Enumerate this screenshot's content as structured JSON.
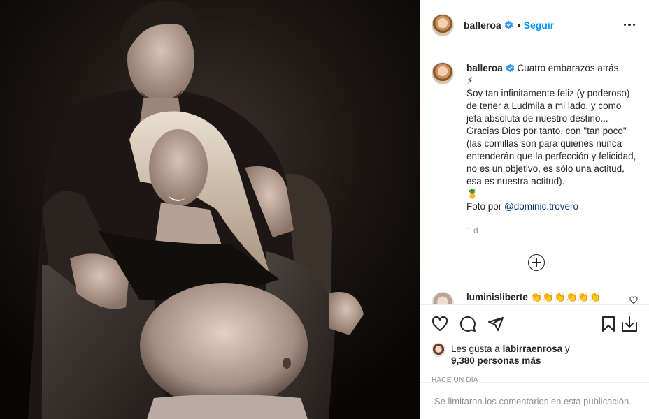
{
  "post": {
    "username": "balleroa",
    "follow_label": "Seguir",
    "dot": "•",
    "caption_lines": [
      " Cuatro embarazos atrás.",
      "⚡",
      "Soy tan infinitamente feliz (y poderoso) de tener a Ludmila a mi lado, y como jefa absoluta de nuestro destino...",
      "Gracias Dios por tanto, con \"tan poco\" (las comillas son para quienes nunca entenderán que la perfección y felicidad, no es un objetivo, es sólo una actitud, esa es nuestra actitud).",
      "🍍"
    ],
    "photo_credit_prefix": "Foto por ",
    "photo_credit_mention": "@dominic.trovero",
    "caption_time": "1 d"
  },
  "comment": {
    "username": "luminisliberte",
    "text": " 👏👏👏👏👏👏"
  },
  "likes": {
    "prefix": "Les gusta a ",
    "liker": "labirraenrosa",
    "connector": " y",
    "count_text": "9,380 personas más"
  },
  "date_label": "Hace un día",
  "comments_limited": "Se limitaron los comentarios en esta publicación.",
  "icons": {
    "like": "heart-icon",
    "comment": "comment-icon",
    "share": "share-icon",
    "save": "bookmark-icon",
    "download": "download-icon",
    "more": "more-options-icon",
    "verified": "verified-badge-icon",
    "load_more": "plus-circle-icon"
  },
  "colors": {
    "accent": "#0095f6",
    "text": "#262626",
    "muted": "#8e8e8e",
    "verified": "#3897f0"
  }
}
